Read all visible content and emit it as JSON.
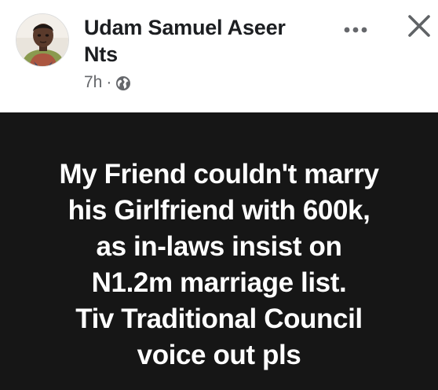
{
  "post": {
    "author": {
      "name_line1": "Udam Samuel Aseer",
      "name_line2": "Nts",
      "avatar_icon": "profile-photo"
    },
    "meta": {
      "time": "7h",
      "separator": "·",
      "privacy_icon": "globe-icon"
    },
    "actions": {
      "more_icon": "more-dots-icon",
      "close_icon": "close-icon"
    },
    "content": {
      "lines": [
        "My Friend couldn't marry",
        "his Girlfriend with 600k,",
        "as in-laws insist on",
        "N1.2m marriage list.",
        "Tiv Traditional Council",
        "voice out pls"
      ],
      "background_color": "#161616",
      "text_color": "#ffffff"
    }
  }
}
